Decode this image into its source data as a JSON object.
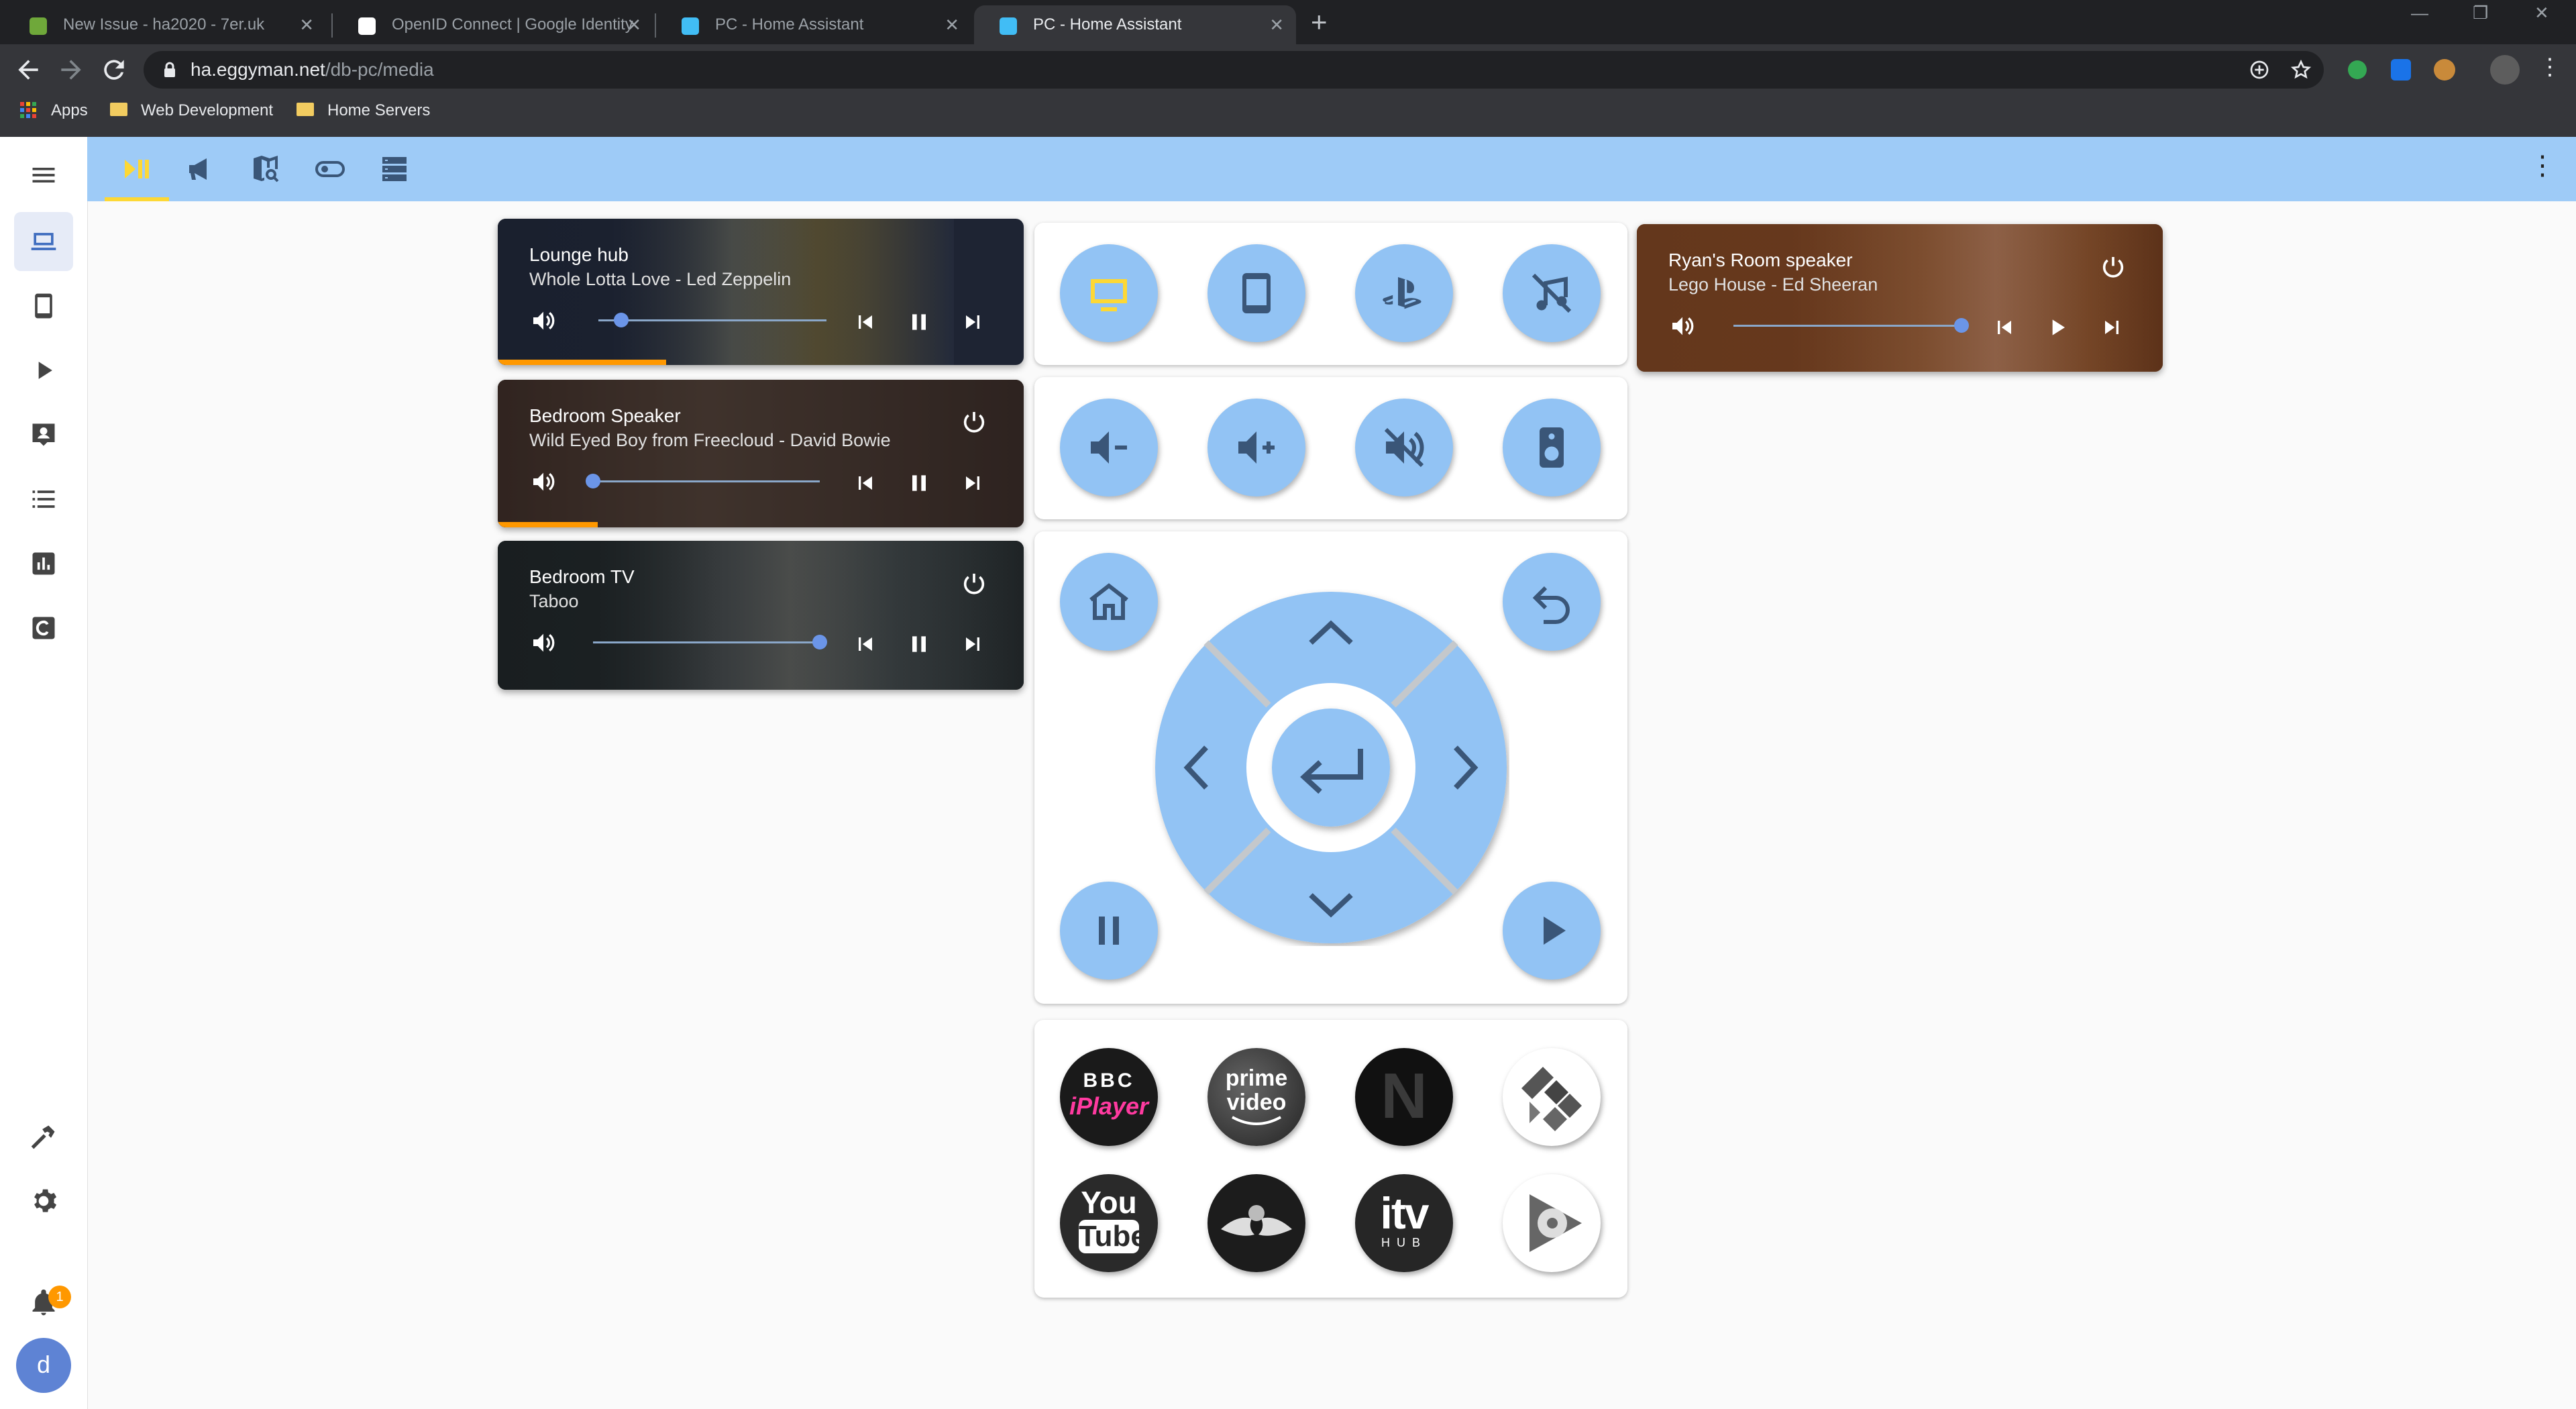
{
  "browser": {
    "tabs": [
      {
        "title": "New Issue - ha2020 - 7er.uk"
      },
      {
        "title": "OpenID Connect | Google Identity"
      },
      {
        "title": "PC - Home Assistant"
      },
      {
        "title": "PC - Home Assistant"
      }
    ],
    "url_domain": "ha.eggyman.net",
    "url_path": "/db-pc/media",
    "bookmarks": [
      "Apps",
      "Web Development",
      "Home Servers"
    ]
  },
  "sidebar": {
    "notification_count": "1",
    "avatar_letter": "d"
  },
  "media_players": [
    {
      "name": "Lounge hub",
      "media": "Whole Lotta Love - Led Zeppelin",
      "volume": 0.1,
      "progress": 0.32,
      "playing": true
    },
    {
      "name": "Bedroom Speaker",
      "media": "Wild Eyed Boy from Freecloud - David Bowie",
      "volume": 0.0,
      "progress": 0.19,
      "playing": true
    },
    {
      "name": "Bedroom TV",
      "media": "Taboo",
      "volume": 1.0,
      "progress": 0,
      "playing": true
    },
    {
      "name": "Ryan's Room speaker",
      "media": "Lego House - Ed Sheeran",
      "volume": 1.0,
      "progress": 0,
      "playing": false
    }
  ],
  "apps": {
    "bbc_line1": "BBC",
    "bbc_line2": "iPlayer",
    "prime_line1": "prime",
    "prime_line2": "video",
    "netflix": "N",
    "youtube_line1": "You",
    "youtube_line2": "Tube",
    "itv": "itv",
    "itv_sub": "HUB"
  },
  "colors": {
    "accent_yellow": "#fdd835",
    "header_blue": "#9ecbf7",
    "button_blue": "#92c3f4",
    "progress_orange": "#ff9800"
  }
}
